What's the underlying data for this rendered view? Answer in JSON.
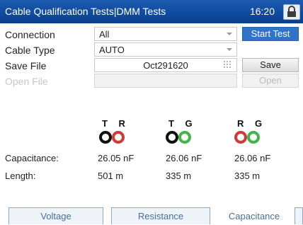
{
  "titlebar": {
    "title": "Cable Qualification Tests|DMM Tests",
    "time": "16:20"
  },
  "form": {
    "connection": {
      "label": "Connection",
      "value": "All"
    },
    "cable_type": {
      "label": "Cable Type",
      "value": "AUTO"
    },
    "save_file": {
      "label": "Save File",
      "value": "Oct291620"
    },
    "open_file": {
      "label": "Open File",
      "value": ""
    }
  },
  "buttons": {
    "start_test": "Start Test",
    "save": "Save",
    "open": "Open"
  },
  "pairs": [
    {
      "letters": "T R",
      "left_color": "#111111",
      "right_color": "#d23a3a"
    },
    {
      "letters": "T G",
      "left_color": "#111111",
      "right_color": "#3fb54a"
    },
    {
      "letters": "R G",
      "left_color": "#d23a3a",
      "right_color": "#3fb54a"
    }
  ],
  "measurements": {
    "capacitance_label": "Capacitance:",
    "length_label": "Length:",
    "capacitance": [
      "26.05 nF",
      "26.06 nF",
      "26.06 nF"
    ],
    "length": [
      "501 m",
      "335 m",
      "335 m"
    ]
  },
  "tabs": [
    "Voltage",
    "Resistance",
    "Capacitance"
  ],
  "colors": {
    "title_bar": "#0f4a9e",
    "primary_button": "#2f74c9",
    "tip_black": "#111111",
    "ring_red": "#d23a3a",
    "ground_green": "#3fb54a"
  }
}
